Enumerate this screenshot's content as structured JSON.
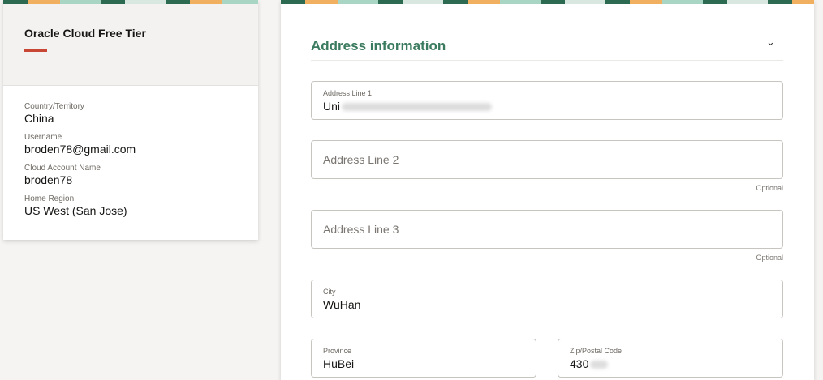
{
  "summary": {
    "title": "Oracle Cloud Free Tier",
    "items": [
      {
        "label": "Country/Territory",
        "value": "China"
      },
      {
        "label": "Username",
        "value": "broden78@gmail.com"
      },
      {
        "label": "Cloud Account Name",
        "value": "broden78"
      },
      {
        "label": "Home Region",
        "value": "US West (San Jose)"
      }
    ]
  },
  "form": {
    "section_title": "Address information",
    "optional": "Optional",
    "address1": {
      "label": "Address Line 1",
      "value": "Uni"
    },
    "address2": {
      "placeholder": "Address Line 2"
    },
    "address3": {
      "placeholder": "Address Line 3"
    },
    "city": {
      "label": "City",
      "value": "WuHan"
    },
    "province": {
      "label": "Province",
      "value": "HuBei"
    },
    "zip": {
      "label": "Zip/Postal Code",
      "value": "430"
    }
  }
}
